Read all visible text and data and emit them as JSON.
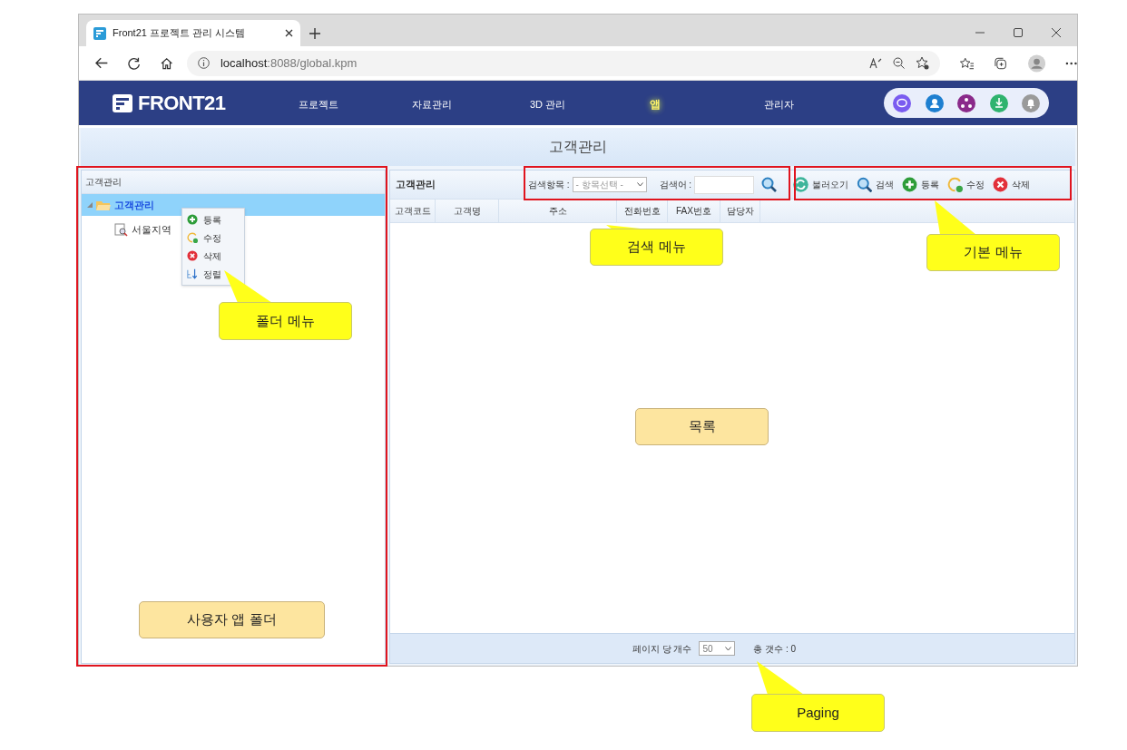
{
  "browser": {
    "tab_title": "Front21 프로젝트 관리 시스템",
    "address": "**localhost**:8088/global.kpm"
  },
  "app": {
    "logo": "FRONT21",
    "nav": [
      {
        "label": "프로젝트",
        "selected": false
      },
      {
        "label": "자료관리",
        "selected": false
      },
      {
        "label": "3D 관리",
        "selected": false
      },
      {
        "label": "앱",
        "selected": true
      },
      {
        "label": "관리자",
        "selected": false
      }
    ],
    "page_title": "고객관리"
  },
  "tree": {
    "header": "고객관리",
    "items": [
      {
        "label": "고객관리",
        "selected": true,
        "expanded": true,
        "children": [
          {
            "label": "서울지역",
            "selected": false
          }
        ]
      }
    ]
  },
  "context_menu": [
    {
      "kind": "add",
      "label": "등록"
    },
    {
      "kind": "edit",
      "label": "수정"
    },
    {
      "kind": "delete",
      "label": "삭제"
    },
    {
      "kind": "sort",
      "label": "정렬"
    }
  ],
  "list": {
    "title": "고객관리",
    "search_label": "검색항목 :",
    "search_select": "- 항목선택 -",
    "keyword_label": "검색어 :",
    "buttons": [
      {
        "kind": "reload",
        "label": "불러오기"
      },
      {
        "kind": "search",
        "label": "검색"
      },
      {
        "kind": "add",
        "label": "등록"
      },
      {
        "kind": "edit",
        "label": "수정"
      },
      {
        "kind": "delete",
        "label": "삭제"
      }
    ],
    "columns": [
      "고객코드",
      "고객명",
      "주소",
      "전화번호",
      "FAX번호",
      "담당자"
    ],
    "per_page_label": "페이지 당 개수",
    "per_page": "50",
    "total": "총 갯수 : 0"
  },
  "annotations": [
    {
      "kind": "pointer",
      "label": "폴더 메뉴"
    },
    {
      "kind": "pointer",
      "label": "검색 메뉴"
    },
    {
      "kind": "pointer",
      "label": "기본 메뉴"
    },
    {
      "kind": "label",
      "label": "목록"
    },
    {
      "kind": "label",
      "label": "사용자 앱 폴더"
    },
    {
      "kind": "pointer",
      "label": "Paging"
    }
  ]
}
